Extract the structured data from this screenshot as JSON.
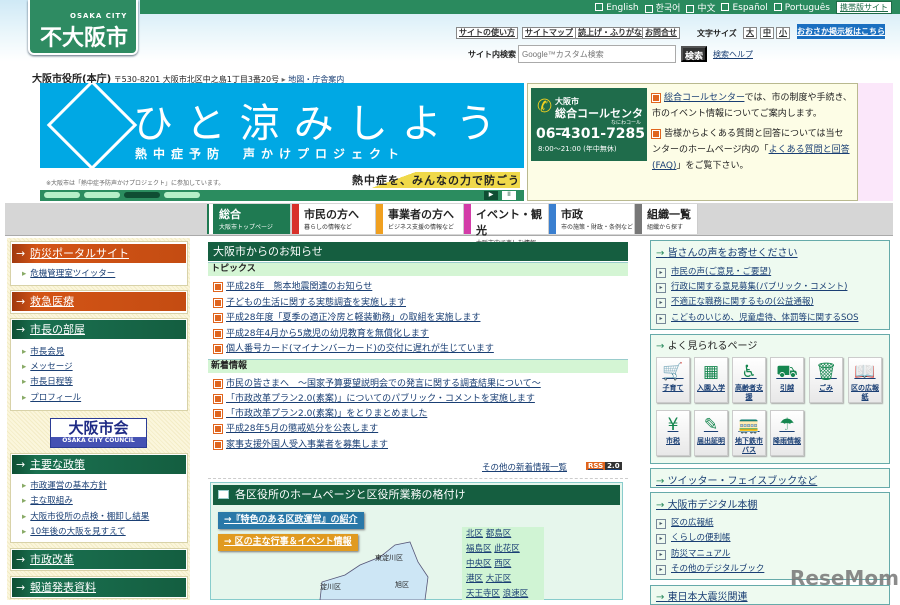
{
  "header": {
    "logo_en": "OSAKA CITY",
    "logo_jp": "大阪市",
    "languages": [
      "English",
      "한국어",
      "中文",
      "Español",
      "Português"
    ],
    "mobile": "携帯版サイト",
    "tools": [
      "サイトの使い方",
      "サイトマップ",
      "読上げ・ふりがな",
      "お問合せ"
    ],
    "font_size_label": "文字サイズ",
    "font_sizes": [
      "大",
      "中",
      "小"
    ],
    "bbs": "おおさか掲示板はこちら",
    "search_label": "サイト内検索",
    "search_placeholder": "Google™カスタム検索",
    "search_button": "検索",
    "search_help": "検索ヘルプ",
    "office": "大阪市役所(本庁)",
    "address": "〒530-8201 大阪市北区中之島1丁目3番20号",
    "map_link": "地図・庁舎案内"
  },
  "banner": {
    "title": "ひと涼みしよう",
    "subtitle": "熱中症予防　声かけプロジェクト",
    "note": "※大阪市は「熱中症予防声かけプロジェクト」に参加しています。",
    "slogan": "熱中症を、みんなの力で防ごう"
  },
  "call_center": {
    "city": "大阪市",
    "name": "総合コールセンター",
    "kana": "なにわコール",
    "phone": "06-4301-7285",
    "hours": "8:00～21:00 (年中無休)",
    "text1_link": "総合コールセンター",
    "text1": "では、市の制度や手続き、市のイベント情報についてご案内します。",
    "text2": "皆様からよくある質問と回答については当センターのホームページ内の「",
    "text2_link": "よくある質問と回答(FAQ)",
    "text2_end": "」をご覧下さい。"
  },
  "nav": [
    {
      "label": "総合",
      "sub": "大阪市トップページ",
      "color": "#ffffff"
    },
    {
      "label": "市民の方へ",
      "sub": "暮らしの情報など",
      "color": "#d8302a"
    },
    {
      "label": "事業者の方へ",
      "sub": "ビジネス支援の情報など",
      "color": "#f0a020"
    },
    {
      "label": "イベント・観光",
      "sub": "大阪市内で楽しむ情報",
      "color": "#d33ca8"
    },
    {
      "label": "市政",
      "sub": "市の施策・財政・条例など",
      "color": "#3a7fd0"
    },
    {
      "label": "組織一覧",
      "sub": "組織から探す",
      "color": "#777777"
    }
  ],
  "left": {
    "bousai": "防災ポータルサイト",
    "bousai_items": [
      "危機管理室ツイッター"
    ],
    "kyukyu": "救急医療",
    "mayor": "市長の部屋",
    "mayor_items": [
      "市長会見",
      "メッセージ",
      "市長日程等",
      "プロフィール"
    ],
    "council_jp": "大阪市会",
    "council_en": "OSAKA CITY COUNCIL",
    "policy": "主要な政策",
    "policy_items": [
      "市政運営の基本方針",
      "主な取組み",
      "大阪市役所の点検・棚卸し結果",
      "10年後の大阪を見すえて"
    ],
    "reform": "市政改革",
    "press": "報道発表資料"
  },
  "center": {
    "title": "大阪市からのお知らせ",
    "topics_label": "トピックス",
    "topics": [
      "平成28年　熊本地震関連のお知らせ",
      "子どもの生活に関する実態調査を実施します",
      "平成28年度「夏季の適正冷房と軽装勤務」の取組を実施します",
      "平成28年4月から5歳児の幼児教育を無償化します",
      "個人番号カード(マイナンバーカード)の交付に遅れが生じています"
    ],
    "news_label": "新着情報",
    "news": [
      "市民の皆さまへ　～国家予算要望説明会での発言に関する調査結果について～",
      "「市政改革プラン2.0(素案)」についてのパブリック・コメントを実施します",
      "「市政改革プラン2.0(素案)」をとりまとめました",
      "平成28年5月の懲戒処分を公表します",
      "家事支援外国人受入事業者を募集します"
    ],
    "more": "その他の新着情報一覧",
    "rss": "RSS",
    "rss_ver": "2.0",
    "ward_title": "各区役所のホームページと区役所業務の格付け",
    "ward_btn1": "→『特色のある区政運営』の紹介",
    "ward_btn2": "→ 区の主な行事＆イベント情報",
    "map_labels": [
      "東淀川区",
      "淀川区",
      "旭区"
    ],
    "wards": [
      [
        "北区",
        "都島区"
      ],
      [
        "福島区",
        "此花区"
      ],
      [
        "中央区",
        "西区"
      ],
      [
        "港区",
        "大正区"
      ],
      [
        "天王寺区",
        "浪速区"
      ]
    ]
  },
  "right": {
    "voice": "皆さんの声をお寄せください",
    "voice_items": [
      "市民の声(ご意見・ご要望)",
      "行政に関する意見募集(パブリック・コメント)",
      "不適正な職務に関するもの(公益通報)",
      "こどものいじめ、児童虐待、体罰等に関するSOS"
    ],
    "popular": "よく見られるページ",
    "tiles": [
      {
        "icon": "stroller",
        "label": "子育て"
      },
      {
        "icon": "school",
        "label": "入園入学"
      },
      {
        "icon": "elderly",
        "label": "高齢者支援"
      },
      {
        "icon": "truck",
        "label": "引越"
      },
      {
        "icon": "trash",
        "label": "ごみ"
      },
      {
        "icon": "book",
        "label": "区の広報紙"
      },
      {
        "icon": "yen",
        "label": "市税"
      },
      {
        "icon": "form",
        "label": "届出証明"
      },
      {
        "icon": "train",
        "label": "地下鉄市バス"
      },
      {
        "icon": "umbrella",
        "label": "降雨情報"
      }
    ],
    "sns": "ツイッター・フェイスブックなど",
    "digital": "大阪市デジタル本棚",
    "digital_items": [
      "区の広報紙",
      "くらしの便利帳",
      "防災マニュアル",
      "その他のデジタルブック"
    ],
    "quake": "東日本大震災関連"
  },
  "watermark": "ReseMom"
}
